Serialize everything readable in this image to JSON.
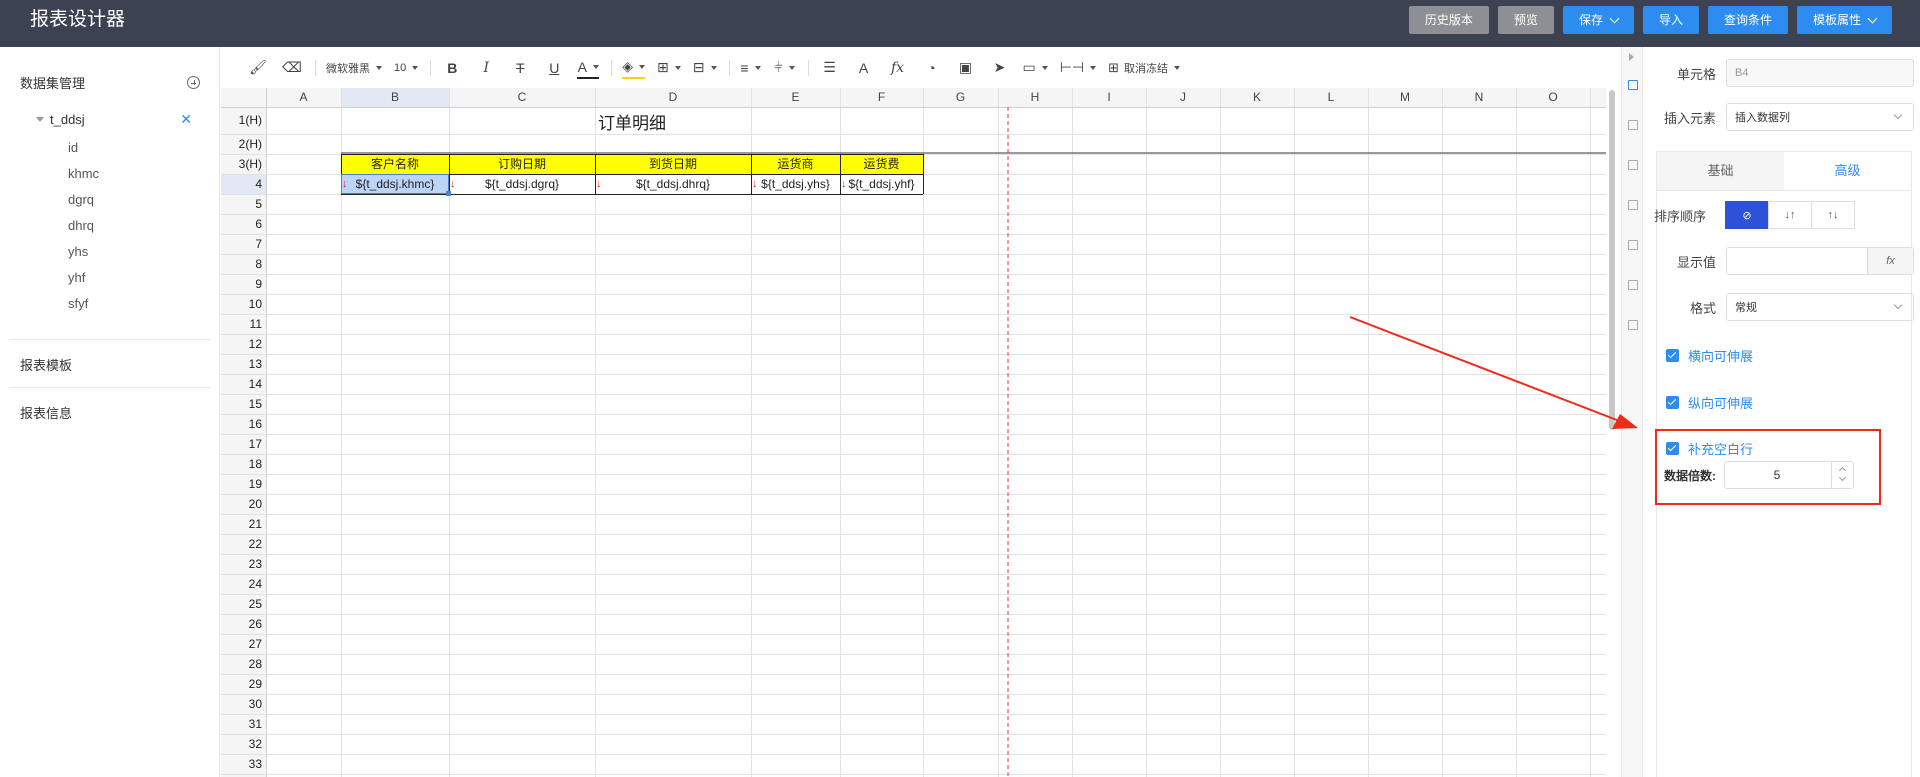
{
  "app": {
    "title": "报表设计器"
  },
  "top_actions": [
    {
      "label": "历史版本",
      "style": "gray",
      "dropdown": false
    },
    {
      "label": "预览",
      "style": "gray",
      "dropdown": false
    },
    {
      "label": "保存",
      "style": "blue",
      "dropdown": true
    },
    {
      "label": "导入",
      "style": "blue",
      "dropdown": false
    },
    {
      "label": "查询条件",
      "style": "blue",
      "dropdown": false
    },
    {
      "label": "模板属性",
      "style": "blue",
      "dropdown": true
    }
  ],
  "sidebar": {
    "dataset_title": "数据集管理",
    "dataset_name": "t_ddsj",
    "fields": [
      "id",
      "khmc",
      "dgrq",
      "dhrq",
      "yhs",
      "yhf",
      "sfyf"
    ],
    "sections": [
      "报表模板",
      "报表信息"
    ]
  },
  "toolbar": {
    "font_family": "微软雅黑",
    "font_size": "10",
    "freeze_label": "取消冻结"
  },
  "sheet": {
    "columns": [
      "A",
      "B",
      "C",
      "D",
      "E",
      "F",
      "G",
      "H",
      "I",
      "J",
      "K",
      "L",
      "M",
      "N",
      "O"
    ],
    "rows": [
      "1(H)",
      "2(H)",
      "3(H)",
      "4",
      "5",
      "6",
      "7",
      "8",
      "9",
      "10",
      "11",
      "12",
      "13",
      "14",
      "15",
      "16",
      "17",
      "18",
      "19",
      "20",
      "21",
      "22",
      "23",
      "24",
      "25",
      "26",
      "27",
      "28",
      "29",
      "30",
      "31",
      "32",
      "33"
    ],
    "report_title": "订单明细",
    "headers": [
      "客户名称",
      "订购日期",
      "到货日期",
      "运货商",
      "运货费"
    ],
    "bindings": [
      "${t_ddsj.khmc}",
      "${t_ddsj.dgrq}",
      "${t_ddsj.dhrq}",
      "${t_ddsj.yhs}",
      "${t_ddsj.yhf}"
    ],
    "selected_cell": "B4",
    "header_fill": "#ffff00"
  },
  "panel": {
    "cell_label": "单元格",
    "cell_value": "B4",
    "insert_label": "插入元素",
    "insert_value": "插入数据列",
    "tabs": [
      "基础",
      "高级"
    ],
    "active_tab": "高级",
    "sort_label": "排序顺序",
    "sort_options": [
      "⊘",
      "↓↑",
      "↑↓"
    ],
    "display_label": "显示值",
    "display_fx": "fx",
    "format_label": "格式",
    "format_value": "常规",
    "checks": [
      "横向可伸展",
      "纵向可伸展",
      "补充空白行"
    ],
    "multiplier_label": "数据倍数:",
    "multiplier_value": "5"
  },
  "colors": {
    "accent": "#2d8cf0",
    "header_bg": "#3c4252",
    "highlight_box": "#f02a1a"
  }
}
